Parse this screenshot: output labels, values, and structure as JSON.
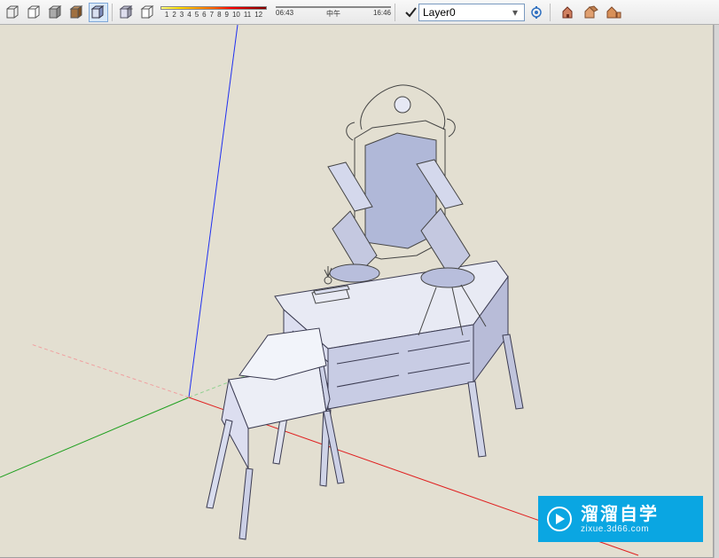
{
  "toolbar": {
    "gradient_numbers": [
      "1",
      "2",
      "3",
      "4",
      "5",
      "6",
      "7",
      "8",
      "9",
      "10",
      "11",
      "12"
    ],
    "time_start": "06:43",
    "time_mid": "中午",
    "time_end": "16:46"
  },
  "layer": {
    "name": "Layer0"
  },
  "icons": {
    "wire_book": "layer-book",
    "filled_book": "layer-book-filled",
    "refresh": "refresh",
    "xray": "xray",
    "check": "check",
    "lock": "lock",
    "house1": "building-1",
    "house2": "building-2",
    "house3": "building-3"
  },
  "watermark": {
    "title": "溜溜自学",
    "subtitle": "zixue.3d66.com"
  }
}
